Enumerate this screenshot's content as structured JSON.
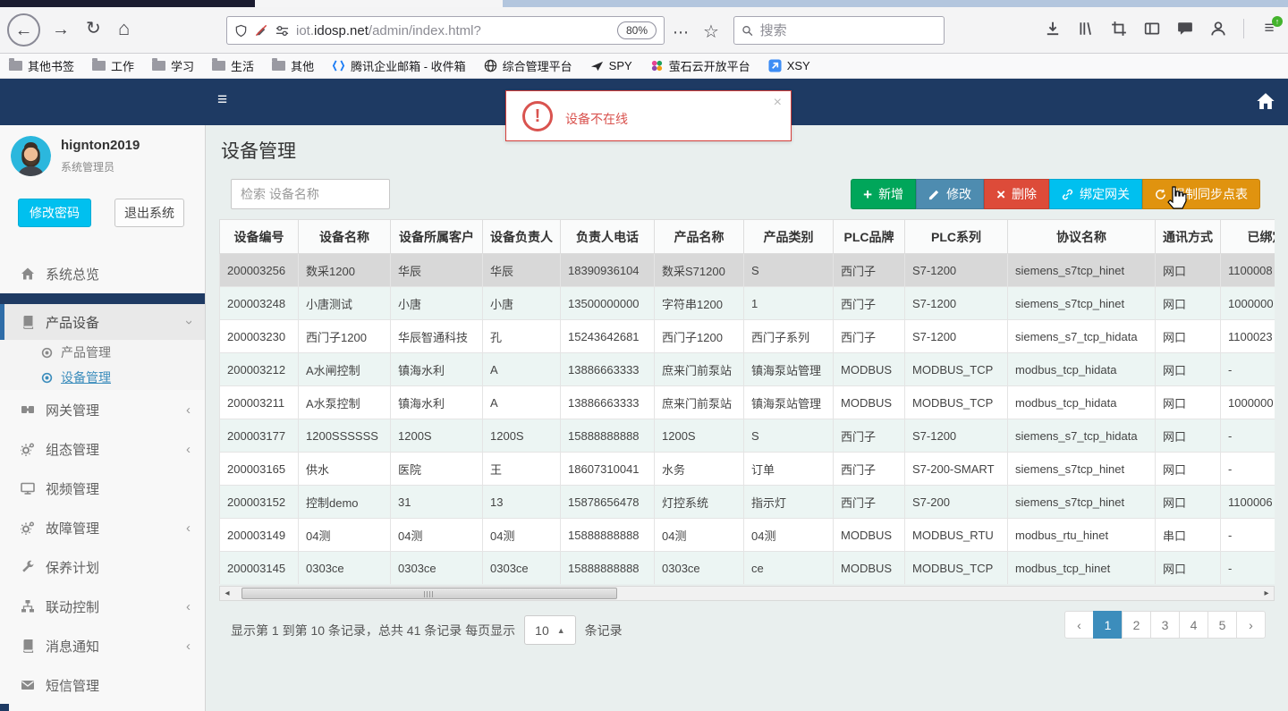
{
  "browser": {
    "url_prefix": "iot.",
    "url_domain": "idosp.net",
    "url_path": "/admin/index.html?",
    "zoom_badge": "80%",
    "search_placeholder": "搜索"
  },
  "bookmarks": {
    "items": [
      {
        "label": "其他书签"
      },
      {
        "label": "工作"
      },
      {
        "label": "学习"
      },
      {
        "label": "生活"
      },
      {
        "label": "其他"
      },
      {
        "label": "腾讯企业邮箱 - 收件箱"
      },
      {
        "label": "综合管理平台"
      },
      {
        "label": "SPY"
      },
      {
        "label": "萤石云开放平台"
      },
      {
        "label": "XSY"
      }
    ]
  },
  "alert": {
    "message": "设备不在线",
    "close": "×"
  },
  "user": {
    "name": "hignton2019",
    "role": "系统管理员",
    "change_password": "修改密码",
    "logout": "退出系统"
  },
  "sidebar": {
    "items": [
      {
        "label": "系统总览"
      },
      {
        "label": "产品设备"
      },
      {
        "label": "产品管理"
      },
      {
        "label": "设备管理"
      },
      {
        "label": "网关管理"
      },
      {
        "label": "组态管理"
      },
      {
        "label": "视频管理"
      },
      {
        "label": "故障管理"
      },
      {
        "label": "保养计划"
      },
      {
        "label": "联动控制"
      },
      {
        "label": "消息通知"
      },
      {
        "label": "短信管理"
      }
    ]
  },
  "page": {
    "title": "设备管理"
  },
  "search": {
    "placeholder": "检索 设备名称"
  },
  "toolbar": {
    "add": "新增",
    "edit": "修改",
    "delete": "删除",
    "bind_gateway": "绑定网关",
    "force_sync": "强制同步点表"
  },
  "table": {
    "columns": [
      "设备编号",
      "设备名称",
      "设备所属客户",
      "设备负责人",
      "负责人电话",
      "产品名称",
      "产品类别",
      "PLC品牌",
      "PLC系列",
      "协议名称",
      "通讯方式",
      "已绑定网关"
    ],
    "rows": [
      {
        "selected": true,
        "cells": [
          "200003256",
          "数采1200",
          "华辰",
          "华辰",
          "18390936104",
          "数采S71200",
          "S",
          "西门子",
          "S7-1200",
          "siemens_s7tcp_hinet",
          "网口",
          "1100008"
        ]
      },
      {
        "selected": false,
        "cells": [
          "200003248",
          "小唐测试",
          "小唐",
          "小唐",
          "13500000000",
          "字符串1200",
          "1",
          "西门子",
          "S7-1200",
          "siemens_s7tcp_hinet",
          "网口",
          "1000000"
        ]
      },
      {
        "selected": false,
        "cells": [
          "200003230",
          "西门子1200",
          "华辰智通科技",
          "孔",
          "15243642681",
          "西门子1200",
          "西门子系列",
          "西门子",
          "S7-1200",
          "siemens_s7_tcp_hidata",
          "网口",
          "1100023"
        ]
      },
      {
        "selected": false,
        "cells": [
          "200003212",
          "A水闸控制",
          "镇海水利",
          "A",
          "13886663333",
          "庶来门前泵站",
          "镇海泵站管理",
          "MODBUS",
          "MODBUS_TCP",
          "modbus_tcp_hidata",
          "网口",
          "-"
        ]
      },
      {
        "selected": false,
        "cells": [
          "200003211",
          "A水泵控制",
          "镇海水利",
          "A",
          "13886663333",
          "庶来门前泵站",
          "镇海泵站管理",
          "MODBUS",
          "MODBUS_TCP",
          "modbus_tcp_hidata",
          "网口",
          "1000000"
        ]
      },
      {
        "selected": false,
        "cells": [
          "200003177",
          "1200SSSSSS",
          "1200S",
          "1200S",
          "15888888888",
          "1200S",
          "S",
          "西门子",
          "S7-1200",
          "siemens_s7_tcp_hidata",
          "网口",
          "-"
        ]
      },
      {
        "selected": false,
        "cells": [
          "200003165",
          "供水",
          "医院",
          "王",
          "18607310041",
          "水务",
          "订单",
          "西门子",
          "S7-200-SMART",
          "siemens_s7tcp_hinet",
          "网口",
          "-"
        ]
      },
      {
        "selected": false,
        "cells": [
          "200003152",
          "控制demo",
          "31",
          "13",
          "15878656478",
          "灯控系统",
          "指示灯",
          "西门子",
          "S7-200",
          "siemens_s7tcp_hinet",
          "网口",
          "1100006"
        ]
      },
      {
        "selected": false,
        "cells": [
          "200003149",
          "04测",
          "04测",
          "04测",
          "15888888888",
          "04测",
          "04测",
          "MODBUS",
          "MODBUS_RTU",
          "modbus_rtu_hinet",
          "串口",
          "-"
        ]
      },
      {
        "selected": false,
        "cells": [
          "200003145",
          "0303ce",
          "0303ce",
          "0303ce",
          "15888888888",
          "0303ce",
          "ce",
          "MODBUS",
          "MODBUS_TCP",
          "modbus_tcp_hinet",
          "网口",
          "-"
        ]
      }
    ]
  },
  "footer": {
    "info_prefix": "显示第 1 到第 10 条记录，总共 41 条记录 每页显示",
    "page_size": "10",
    "info_suffix": "条记录"
  },
  "pagination": {
    "prev": "‹",
    "next": "›",
    "pages": [
      "1",
      "2",
      "3",
      "4",
      "5"
    ],
    "active": "1"
  },
  "icons": {
    "back": "←",
    "forward": "→",
    "reload": "↻",
    "home": "⌂",
    "dots": "⋯",
    "star": "☆",
    "hamburger": "≡",
    "chevron": "‹",
    "caret_up": "▲",
    "scroll_left": "◂",
    "scroll_right": "▸"
  },
  "colors": {
    "navbar": "#1e3a63",
    "accent": "#3c8dbc",
    "success": "#00a65a",
    "danger": "#dd4b39",
    "info": "#00c0ef",
    "warning": "#e0930f"
  }
}
